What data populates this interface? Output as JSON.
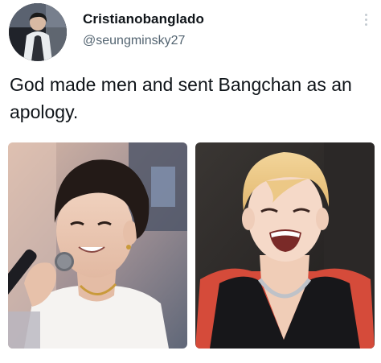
{
  "tweet": {
    "display_name": "Cristianobanglado",
    "handle": "@seungminsky27",
    "text": "God made men and sent Bangchan as an apology."
  },
  "icons": {
    "more": "more-vertical-icon"
  },
  "colors": {
    "text": "#0f1419",
    "secondary_text": "#536471",
    "menu_dots": "#c4cbd1"
  }
}
